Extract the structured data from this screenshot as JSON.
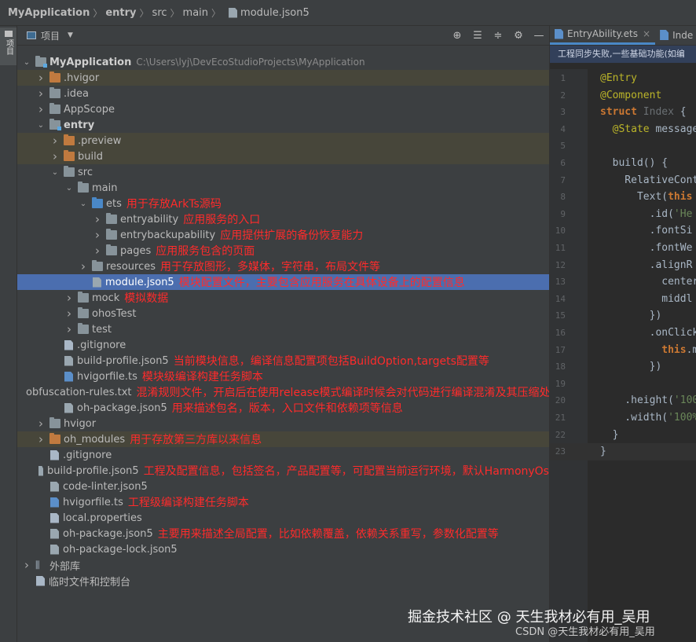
{
  "breadcrumb": {
    "items": [
      "MyApplication",
      "entry",
      "src",
      "main"
    ],
    "file": "module.json5"
  },
  "left_stripe": {
    "label": "项目"
  },
  "panel": {
    "title": "项目",
    "tools": [
      "target-icon",
      "expand-all-icon",
      "collapse-all-icon",
      "gear-icon",
      "minimize-icon"
    ]
  },
  "tree": [
    {
      "label": "MyApplication",
      "path": "C:\\Users\\lyj\\DevEcoStudioProjects\\MyApplication",
      "bold": true,
      "depth": 0,
      "arrow": "open",
      "icon": "module-folder"
    },
    {
      "label": ".hvigor",
      "depth": 1,
      "arrow": "closed",
      "icon": "folder-orange",
      "excluded": true
    },
    {
      "label": ".idea",
      "depth": 1,
      "arrow": "closed",
      "icon": "folder"
    },
    {
      "label": "AppScope",
      "depth": 1,
      "arrow": "closed",
      "icon": "folder"
    },
    {
      "label": "entry",
      "depth": 1,
      "arrow": "open",
      "icon": "module-folder",
      "bold": true
    },
    {
      "label": ".preview",
      "depth": 2,
      "arrow": "closed",
      "icon": "folder-orange",
      "excluded": true
    },
    {
      "label": "build",
      "depth": 2,
      "arrow": "closed",
      "icon": "folder-orange",
      "excluded": true
    },
    {
      "label": "src",
      "depth": 2,
      "arrow": "open",
      "icon": "folder"
    },
    {
      "label": "main",
      "depth": 3,
      "arrow": "open",
      "icon": "folder"
    },
    {
      "label": "ets",
      "depth": 4,
      "arrow": "open",
      "icon": "folder-blue",
      "note": "用于存放ArkTs源码"
    },
    {
      "label": "entryability",
      "depth": 5,
      "arrow": "closed",
      "icon": "folder",
      "note": "应用服务的入口"
    },
    {
      "label": "entrybackupability",
      "depth": 5,
      "arrow": "closed",
      "icon": "folder",
      "note": "应用提供扩展的备份恢复能力"
    },
    {
      "label": "pages",
      "depth": 5,
      "arrow": "closed",
      "icon": "folder",
      "note": "应用服务包含的页面"
    },
    {
      "label": "resources",
      "depth": 4,
      "arrow": "closed",
      "icon": "folder",
      "note": "用于存放图形，多媒体，字符串，布局文件等"
    },
    {
      "label": "module.json5",
      "depth": 4,
      "arrow": "none",
      "icon": "file",
      "selected": true,
      "note": "模块配置文件，主要包含应用服务在具体设备上的配置信息"
    },
    {
      "label": "mock",
      "depth": 3,
      "arrow": "closed",
      "icon": "folder",
      "note": "模拟数据"
    },
    {
      "label": "ohosTest",
      "depth": 3,
      "arrow": "closed",
      "icon": "folder"
    },
    {
      "label": "test",
      "depth": 3,
      "arrow": "closed",
      "icon": "folder"
    },
    {
      "label": ".gitignore",
      "depth": 2,
      "arrow": "none",
      "icon": "file-lines"
    },
    {
      "label": "build-profile.json5",
      "depth": 2,
      "arrow": "none",
      "icon": "file",
      "note": "当前模块信息，编译信息配置项包括BuildOption,targets配置等"
    },
    {
      "label": "hvigorfile.ts",
      "depth": 2,
      "arrow": "none",
      "icon": "file-ts",
      "note": "模块级编译构建任务脚本"
    },
    {
      "label": "obfuscation-rules.txt",
      "depth": 2,
      "arrow": "none",
      "icon": "file-lines",
      "note": "混淆规则文件，开启后在使用release模式编译时候会对代码进行编译混淆及其压缩处理"
    },
    {
      "label": "oh-package.json5",
      "depth": 2,
      "arrow": "none",
      "icon": "file",
      "note": "用来描述包名，版本，入口文件和依赖项等信息"
    },
    {
      "label": "hvigor",
      "depth": 1,
      "arrow": "closed",
      "icon": "folder"
    },
    {
      "label": "oh_modules",
      "depth": 1,
      "arrow": "closed",
      "icon": "folder-orange",
      "excluded": true,
      "note": "用于存放第三方库以来信息"
    },
    {
      "label": ".gitignore",
      "depth": 1,
      "arrow": "none",
      "icon": "file-lines"
    },
    {
      "label": "build-profile.json5",
      "depth": 1,
      "arrow": "none",
      "icon": "file",
      "note": "工程及配置信息，包括签名，产品配置等，可配置当前运行环境，默认HarmonyOs"
    },
    {
      "label": "code-linter.json5",
      "depth": 1,
      "arrow": "none",
      "icon": "file"
    },
    {
      "label": "hvigorfile.ts",
      "depth": 1,
      "arrow": "none",
      "icon": "file-ts",
      "note": "工程级编译构建任务脚本"
    },
    {
      "label": "local.properties",
      "depth": 1,
      "arrow": "none",
      "icon": "file-lines"
    },
    {
      "label": "oh-package.json5",
      "depth": 1,
      "arrow": "none",
      "icon": "file",
      "note": "主要用来描述全局配置，比如依赖覆盖，依赖关系重写，参数化配置等"
    },
    {
      "label": "oh-package-lock.json5",
      "depth": 1,
      "arrow": "none",
      "icon": "file"
    },
    {
      "label": "外部库",
      "depth": 0,
      "arrow": "closed",
      "icon": "library"
    },
    {
      "label": "临时文件和控制台",
      "depth": 0,
      "arrow": "none",
      "icon": "scratch"
    }
  ],
  "editor": {
    "tabs": [
      {
        "label": "EntryAbility.ets",
        "active": true
      },
      {
        "label": "Inde",
        "active": false
      }
    ],
    "banner": "工程同步失败,一些基础功能(如编",
    "lines": [
      {
        "n": "1",
        "html": "<span class='ann-y'>@Entry</span>"
      },
      {
        "n": "2",
        "html": "<span class='ann-y'>@Component</span>"
      },
      {
        "n": "3",
        "html": "<span class='kw'>struct</span> <span class='dim'>Index</span> {"
      },
      {
        "n": "4",
        "html": "  <span class='ann-y'>@State</span> message"
      },
      {
        "n": "5",
        "html": ""
      },
      {
        "n": "6",
        "html": "  build() {"
      },
      {
        "n": "7",
        "html": "    RelativeCont"
      },
      {
        "n": "8",
        "html": "      Text(<span class='kw'>this</span>"
      },
      {
        "n": "9",
        "html": "        .id(<span class='str'>'He</span>"
      },
      {
        "n": "10",
        "html": "        .fontSi"
      },
      {
        "n": "11",
        "html": "        .fontWe"
      },
      {
        "n": "12",
        "html": "        .alignR"
      },
      {
        "n": "13",
        "html": "          center"
      },
      {
        "n": "14",
        "html": "          middl"
      },
      {
        "n": "15",
        "html": "        })"
      },
      {
        "n": "16",
        "html": "        .onClick"
      },
      {
        "n": "17",
        "html": "          <span class='kw'>this</span>.m"
      },
      {
        "n": "18",
        "html": "        })"
      },
      {
        "n": "19",
        "html": ""
      },
      {
        "n": "20",
        "html": "    .height(<span class='str'>'100</span>"
      },
      {
        "n": "21",
        "html": "    .width(<span class='str'>'100%</span>"
      },
      {
        "n": "22",
        "html": "  }"
      },
      {
        "n": "23",
        "html": "}"
      }
    ]
  },
  "watermarks": {
    "juejin": "掘金技术社区 @ 天生我材必有用_吴用",
    "csdn": "CSDN @天生我材必有用_吴用"
  }
}
